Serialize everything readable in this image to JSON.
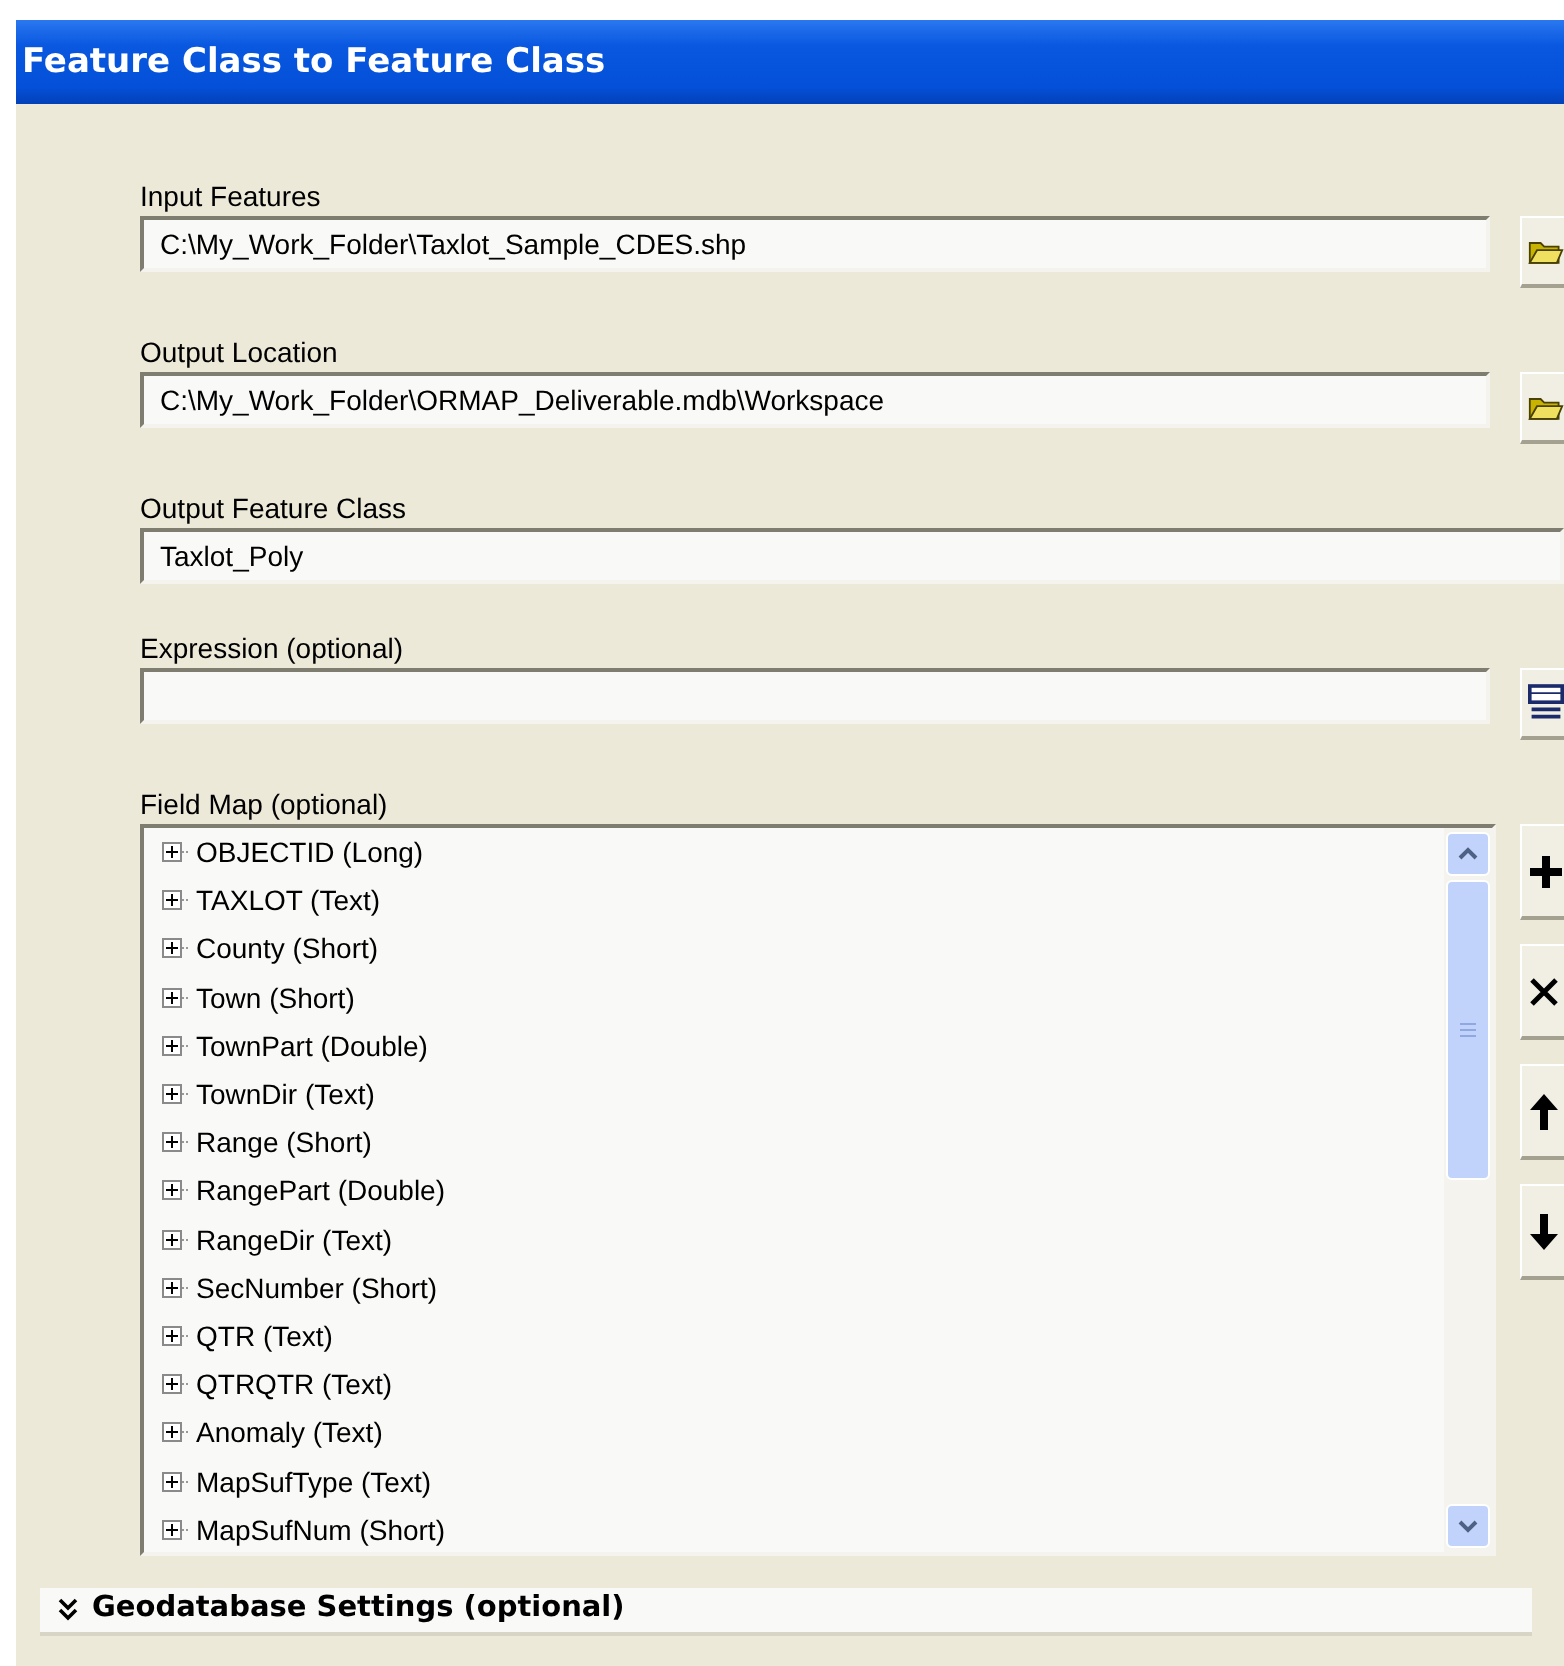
{
  "window": {
    "title": "Feature Class to Feature Class"
  },
  "parameters": [
    {
      "label": "Input Features",
      "kind": "path",
      "value": "C:\\My_Work_Folder\\Taxlot_Sample_CDES.shp"
    },
    {
      "label": "Output Location",
      "kind": "path",
      "value": "C:\\My_Work_Folder\\ORMAP_Deliverable.mdb\\Workspace"
    },
    {
      "label": "Output Feature Class",
      "kind": "text",
      "value": "Taxlot_Poly"
    },
    {
      "label": "Expression (optional)",
      "kind": "expression"
    }
  ],
  "field_map": {
    "label": "Field Map (optional)",
    "items": [
      {
        "text": "OBJECTID (Long)",
        "expanded": false
      },
      {
        "text": "TAXLOT (Text)",
        "expanded": false
      },
      {
        "text": "County (Short)",
        "expanded": false
      },
      {
        "text": "Town (Short)",
        "expanded": false
      },
      {
        "text": "TownPart (Double)",
        "expanded": false
      },
      {
        "text": "TownDir (Text)",
        "expanded": false
      },
      {
        "text": "Range (Short)",
        "expanded": false
      },
      {
        "text": "RangePart (Double)",
        "expanded": false
      },
      {
        "text": "RangeDir (Text)",
        "expanded": false
      },
      {
        "text": "SecNumber (Short)",
        "expanded": false
      },
      {
        "text": "QTR (Text)",
        "expanded": false
      },
      {
        "text": "QTRQTR (Text)",
        "expanded": false
      },
      {
        "text": "Anomaly (Text)",
        "expanded": false
      },
      {
        "text": "MapSufType (Text)",
        "expanded": false
      },
      {
        "text": "MapSufNum (Short)",
        "expanded": false
      }
    ],
    "actions": [
      {
        "kind": "add"
      },
      {
        "kind": "remove"
      },
      {
        "kind": "up"
      },
      {
        "kind": "down"
      }
    ]
  },
  "geodatabase_settings": {
    "title": "Geodatabase Settings (optional)",
    "expanded": false
  }
}
